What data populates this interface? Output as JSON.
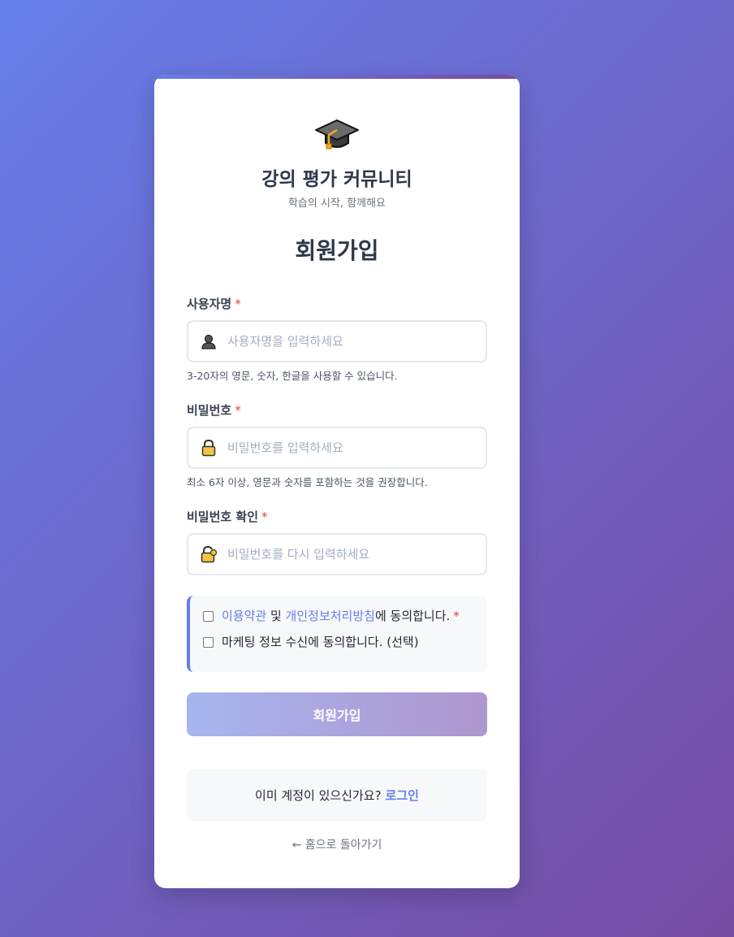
{
  "brand": {
    "logo_icon": "graduation-cap-icon",
    "title": "강의 평가 커뮤니티",
    "subtitle": "학습의 시작, 함께해요"
  },
  "page_title": "회원가입",
  "fields": {
    "username": {
      "label": "사용자명",
      "required_mark": "*",
      "icon": "user-silhouette-icon",
      "placeholder": "사용자명을 입력하세요",
      "value": "",
      "help": "3-20자의 영문, 숫자, 한글을 사용할 수 있습니다."
    },
    "password": {
      "label": "비밀번호",
      "required_mark": "*",
      "icon": "lock-icon",
      "placeholder": "비밀번호를 입력하세요",
      "value": "",
      "help": "최소 6자 이상, 영문과 숫자를 포함하는 것을 권장합니다."
    },
    "password_confirm": {
      "label": "비밀번호 확인",
      "required_mark": "*",
      "icon": "unlocked-lock-icon",
      "placeholder": "비밀번호를 다시 입력하세요",
      "value": ""
    }
  },
  "terms": {
    "terms_link": "이용약관",
    "and_text": " 및 ",
    "privacy_link": "개인정보처리방침",
    "agree_suffix": "에 동의합니다.",
    "required_mark": "*",
    "marketing_label": "마케팅 정보 수신에 동의합니다. (선택)"
  },
  "submit_label": "회원가입",
  "login_prompt": {
    "text": "이미 계정이 있으신가요?",
    "link": "로그인"
  },
  "home_link": "← 홈으로 돌아가기",
  "colors": {
    "accent": "#667eea",
    "gradient_start": "#667eea",
    "gradient_end": "#764ba2",
    "required": "#e53e3e"
  }
}
